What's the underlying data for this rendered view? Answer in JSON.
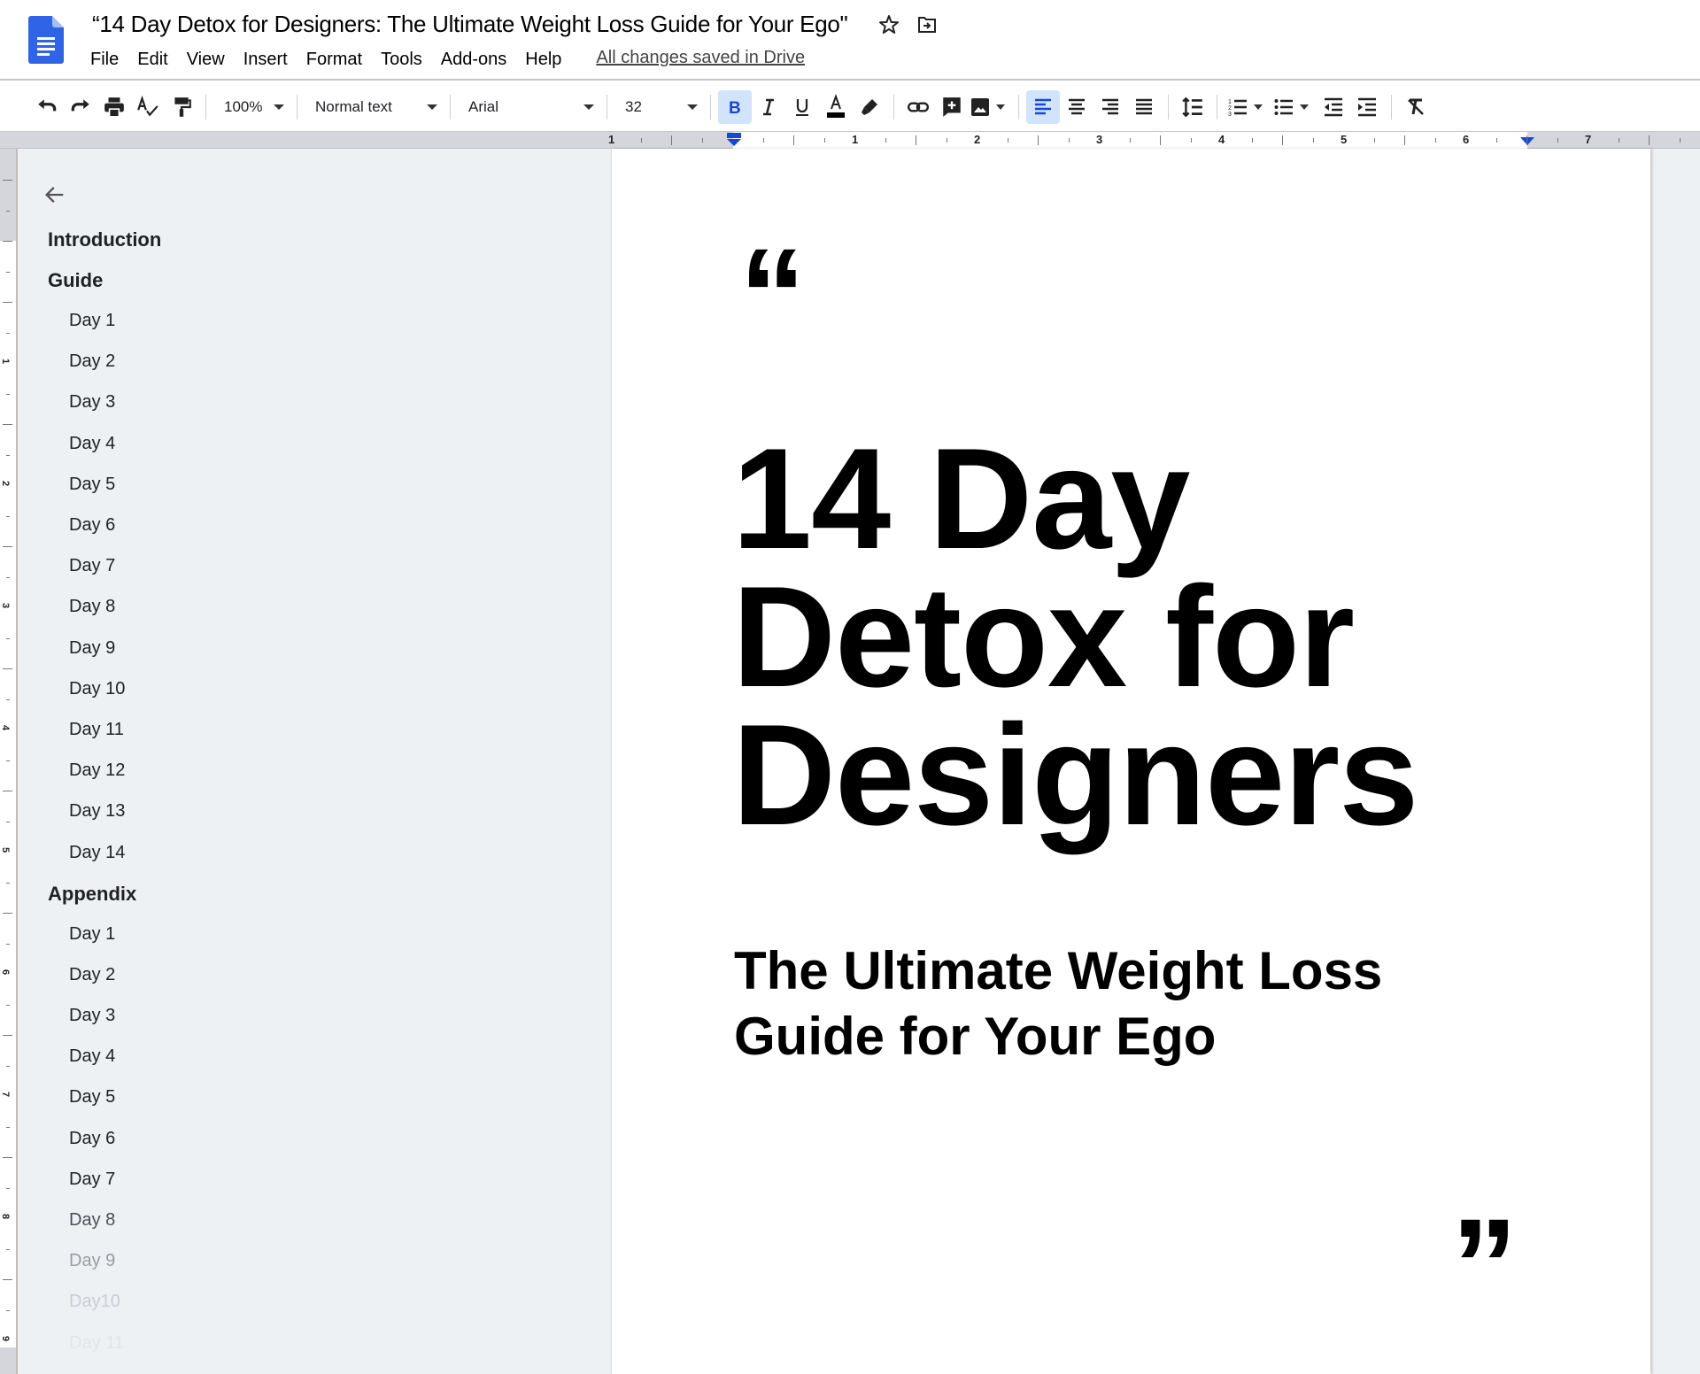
{
  "app": {
    "document_title": "“14 Day Detox for Designers: The Ultimate Weight Loss Guide for Your Ego\"",
    "icons": {
      "logo": "google-docs-icon",
      "star": "star-icon",
      "move": "move-to-folder-icon"
    }
  },
  "menu": {
    "items": [
      "File",
      "Edit",
      "View",
      "Insert",
      "Format",
      "Tools",
      "Add-ons",
      "Help"
    ],
    "save_status": "All changes saved in Drive"
  },
  "toolbar": {
    "zoom": "100%",
    "style": "Normal text",
    "font": "Arial",
    "font_size": "32",
    "bold_active": true,
    "align_left_active": true,
    "accent_color": "#1a47cf",
    "active_bg": "#d2e3fc"
  },
  "ruler": {
    "horizontal_labels": [
      "1",
      "1",
      "2",
      "3",
      "4",
      "5",
      "6",
      "7"
    ],
    "vertical_labels": [
      "1",
      "2",
      "3",
      "4",
      "5",
      "6",
      "7",
      "8",
      "9"
    ]
  },
  "outline": {
    "items": [
      {
        "label": "Introduction",
        "level": 1
      },
      {
        "label": "Guide",
        "level": 1
      },
      {
        "label": "Day 1",
        "level": 2
      },
      {
        "label": "Day 2",
        "level": 2
      },
      {
        "label": "Day 3",
        "level": 2
      },
      {
        "label": "Day 4",
        "level": 2
      },
      {
        "label": "Day 5",
        "level": 2
      },
      {
        "label": "Day 6",
        "level": 2
      },
      {
        "label": "Day 7",
        "level": 2
      },
      {
        "label": "Day 8",
        "level": 2
      },
      {
        "label": "Day 9",
        "level": 2
      },
      {
        "label": "Day 10",
        "level": 2
      },
      {
        "label": "Day 11",
        "level": 2
      },
      {
        "label": "Day 12",
        "level": 2
      },
      {
        "label": "Day 13",
        "level": 2
      },
      {
        "label": "Day 14",
        "level": 2
      },
      {
        "label": "Appendix",
        "level": 1
      },
      {
        "label": "Day 1",
        "level": 2
      },
      {
        "label": "Day 2",
        "level": 2
      },
      {
        "label": "Day 3",
        "level": 2
      },
      {
        "label": "Day 4",
        "level": 2
      },
      {
        "label": "Day 5",
        "level": 2
      },
      {
        "label": "Day 6",
        "level": 2
      },
      {
        "label": "Day 7",
        "level": 2
      },
      {
        "label": "Day 8",
        "level": 2
      },
      {
        "label": "Day 9",
        "level": 2
      },
      {
        "label": "Day10",
        "level": 2
      },
      {
        "label": "Day 11",
        "level": 2
      }
    ]
  },
  "document": {
    "open_quote": "“",
    "heading": "14 Day Detox for Designers",
    "subheading": "The Ultimate Weight Loss Guide for Your Ego",
    "close_quote": "”"
  }
}
